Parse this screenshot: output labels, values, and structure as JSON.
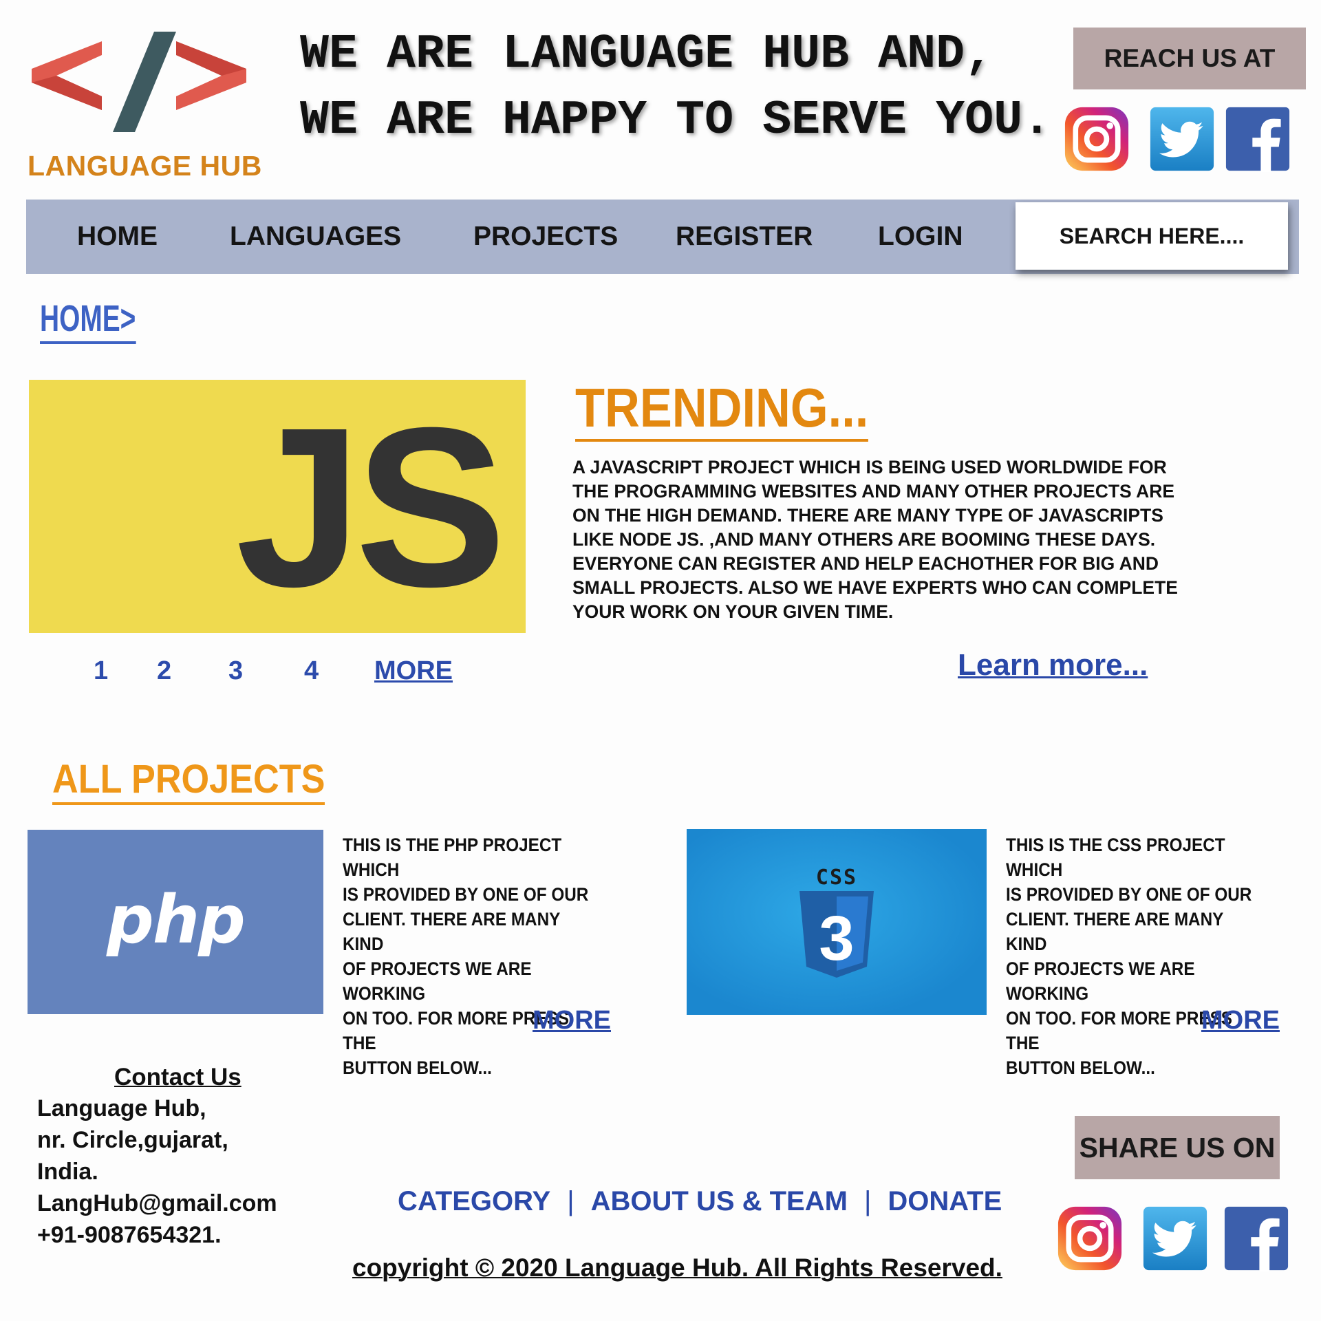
{
  "header": {
    "logo_text": "LANGUAGE HUB",
    "tagline_line1": "WE ARE LANGUAGE HUB AND,",
    "tagline_line2": "WE ARE HAPPY TO SERVE YOU.",
    "reach_label": "REACH US AT",
    "social_icons": [
      "instagram-icon",
      "twitter-icon",
      "facebook-icon"
    ]
  },
  "nav": {
    "items": [
      "HOME",
      "LANGUAGES",
      "PROJECTS",
      "REGISTER",
      "LOGIN"
    ],
    "search_placeholder": "SEARCH HERE...."
  },
  "breadcrumb": "HOME>",
  "trending": {
    "banner_text": "JS",
    "title": "TRENDING...",
    "description": "A JAVASCRIPT PROJECT WHICH IS BEING USED WORLDWIDE FOR\nTHE PROGRAMMING WEBSITES AND MANY OTHER PROJECTS ARE\nON THE HIGH DEMAND. THERE ARE MANY TYPE OF JAVASCRIPTS\nLIKE NODE JS. ,AND MANY OTHERS ARE BOOMING THESE DAYS.\nEVERYONE CAN REGISTER AND HELP EACHOTHER FOR BIG AND\nSMALL PROJECTS. ALSO WE HAVE EXPERTS WHO CAN COMPLETE\nYOUR WORK ON YOUR GIVEN TIME.",
    "pager": [
      "1",
      "2",
      "3",
      "4"
    ],
    "pager_more": "MORE",
    "learn_more": "Learn more..."
  },
  "projects": {
    "title": "ALL PROJECTS",
    "php": {
      "logo_text": "php",
      "description": "THIS IS THE PHP PROJECT WHICH\nIS PROVIDED BY ONE OF OUR\nCLIENT.  THERE ARE MANY KIND\nOF PROJECTS WE ARE WORKING\nON TOO. FOR MORE PRESS THE\nBUTTON BELOW...",
      "more": "MORE"
    },
    "css": {
      "logo_text": "CSS",
      "logo_number": "3",
      "description": "THIS IS THE CSS PROJECT WHICH\nIS PROVIDED BY ONE OF OUR\nCLIENT.  THERE ARE MANY KIND\nOF PROJECTS WE ARE WORKING\nON TOO. FOR MORE PRESS THE\nBUTTON BELOW...",
      "more": "MORE"
    }
  },
  "footer": {
    "contact_title": "Contact Us",
    "contact_lines": [
      "Language Hub,",
      "nr. Circle,gujarat,",
      "India.",
      "LangHub@gmail.com",
      "+91-9087654321."
    ],
    "links": [
      "CATEGORY",
      "ABOUT US & TEAM",
      "DONATE"
    ],
    "link_separator": "|",
    "copyright": "copyright © 2020 Language Hub. All Rights Reserved.",
    "share_label": "SHARE US ON"
  },
  "colors": {
    "nav_bg": "#a9b3cc",
    "accent_orange": "#e38810",
    "link_blue": "#2a48a8",
    "js_yellow": "#efda4f",
    "php_blue": "#6483bd",
    "css_blue": "#1b87cf",
    "badge_bg": "#b8a6a6"
  }
}
